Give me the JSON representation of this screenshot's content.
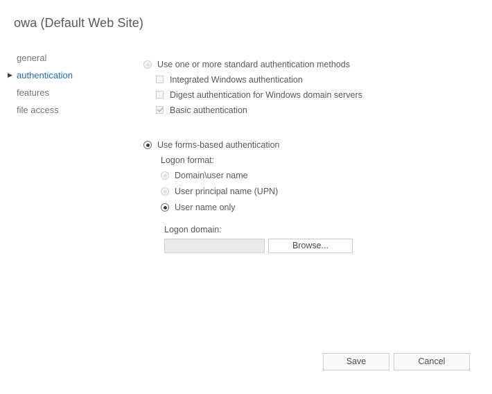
{
  "page": {
    "title": "owa (Default Web Site)"
  },
  "sidebar": {
    "caret_icon": "caret-right-icon",
    "items": [
      {
        "label": "general",
        "selected": false
      },
      {
        "label": "authentication",
        "selected": true
      },
      {
        "label": "features",
        "selected": false
      },
      {
        "label": "file access",
        "selected": false
      }
    ]
  },
  "main": {
    "standard_auth": {
      "label": "Use one or more standard authentication methods",
      "state": "unselected",
      "options": [
        {
          "label": "Integrated Windows authentication",
          "checked": false
        },
        {
          "label": "Digest authentication for Windows domain servers",
          "checked": false
        },
        {
          "label": "Basic authentication",
          "checked": true
        }
      ]
    },
    "forms_auth": {
      "label": "Use forms-based authentication",
      "state": "selected",
      "logon_format_label": "Logon format:",
      "options": [
        {
          "label": "Domain\\user name",
          "checked": false
        },
        {
          "label": "User principal name (UPN)",
          "checked": false
        },
        {
          "label": "User name only",
          "checked": true
        }
      ],
      "logon_domain_label": "Logon domain:",
      "logon_domain_value": "",
      "logon_domain_placeholder": "",
      "browse_label": "Browse..."
    }
  },
  "footer": {
    "save_label": "Save",
    "cancel_label": "Cancel"
  },
  "colors": {
    "accent": "#1970b8",
    "text": "#595959",
    "title": "#5a5a5a"
  }
}
